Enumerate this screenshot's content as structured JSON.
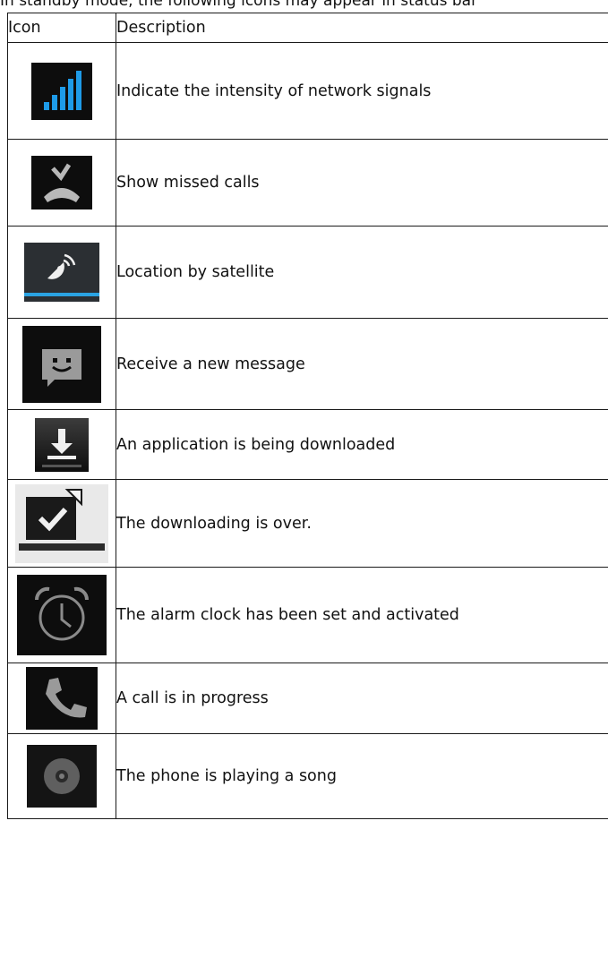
{
  "intro_text": "In standby mode, the following icons may appear in status bar",
  "table": {
    "headers": {
      "icon": "Icon",
      "description": "Description"
    },
    "rows": [
      {
        "icon": "signal-strength-icon",
        "description": "Indicate the intensity of network signals"
      },
      {
        "icon": "missed-call-icon",
        "description": "Show missed calls"
      },
      {
        "icon": "satellite-location-icon",
        "description": "Location by satellite"
      },
      {
        "icon": "new-message-icon",
        "description": "Receive a new message"
      },
      {
        "icon": "downloading-icon",
        "description": "An application is being downloaded"
      },
      {
        "icon": "download-complete-icon",
        "description": "The downloading is over."
      },
      {
        "icon": "alarm-clock-icon",
        "description": "The alarm clock has been set and activated"
      },
      {
        "icon": "call-in-progress-icon",
        "description": "A call is in progress"
      },
      {
        "icon": "music-playing-icon",
        "description": "The phone is playing a song"
      }
    ]
  },
  "colors": {
    "icon_background": "#0d0d0d",
    "signal_blue": "#1e9be8",
    "icon_grey": "#8a8a8a"
  }
}
